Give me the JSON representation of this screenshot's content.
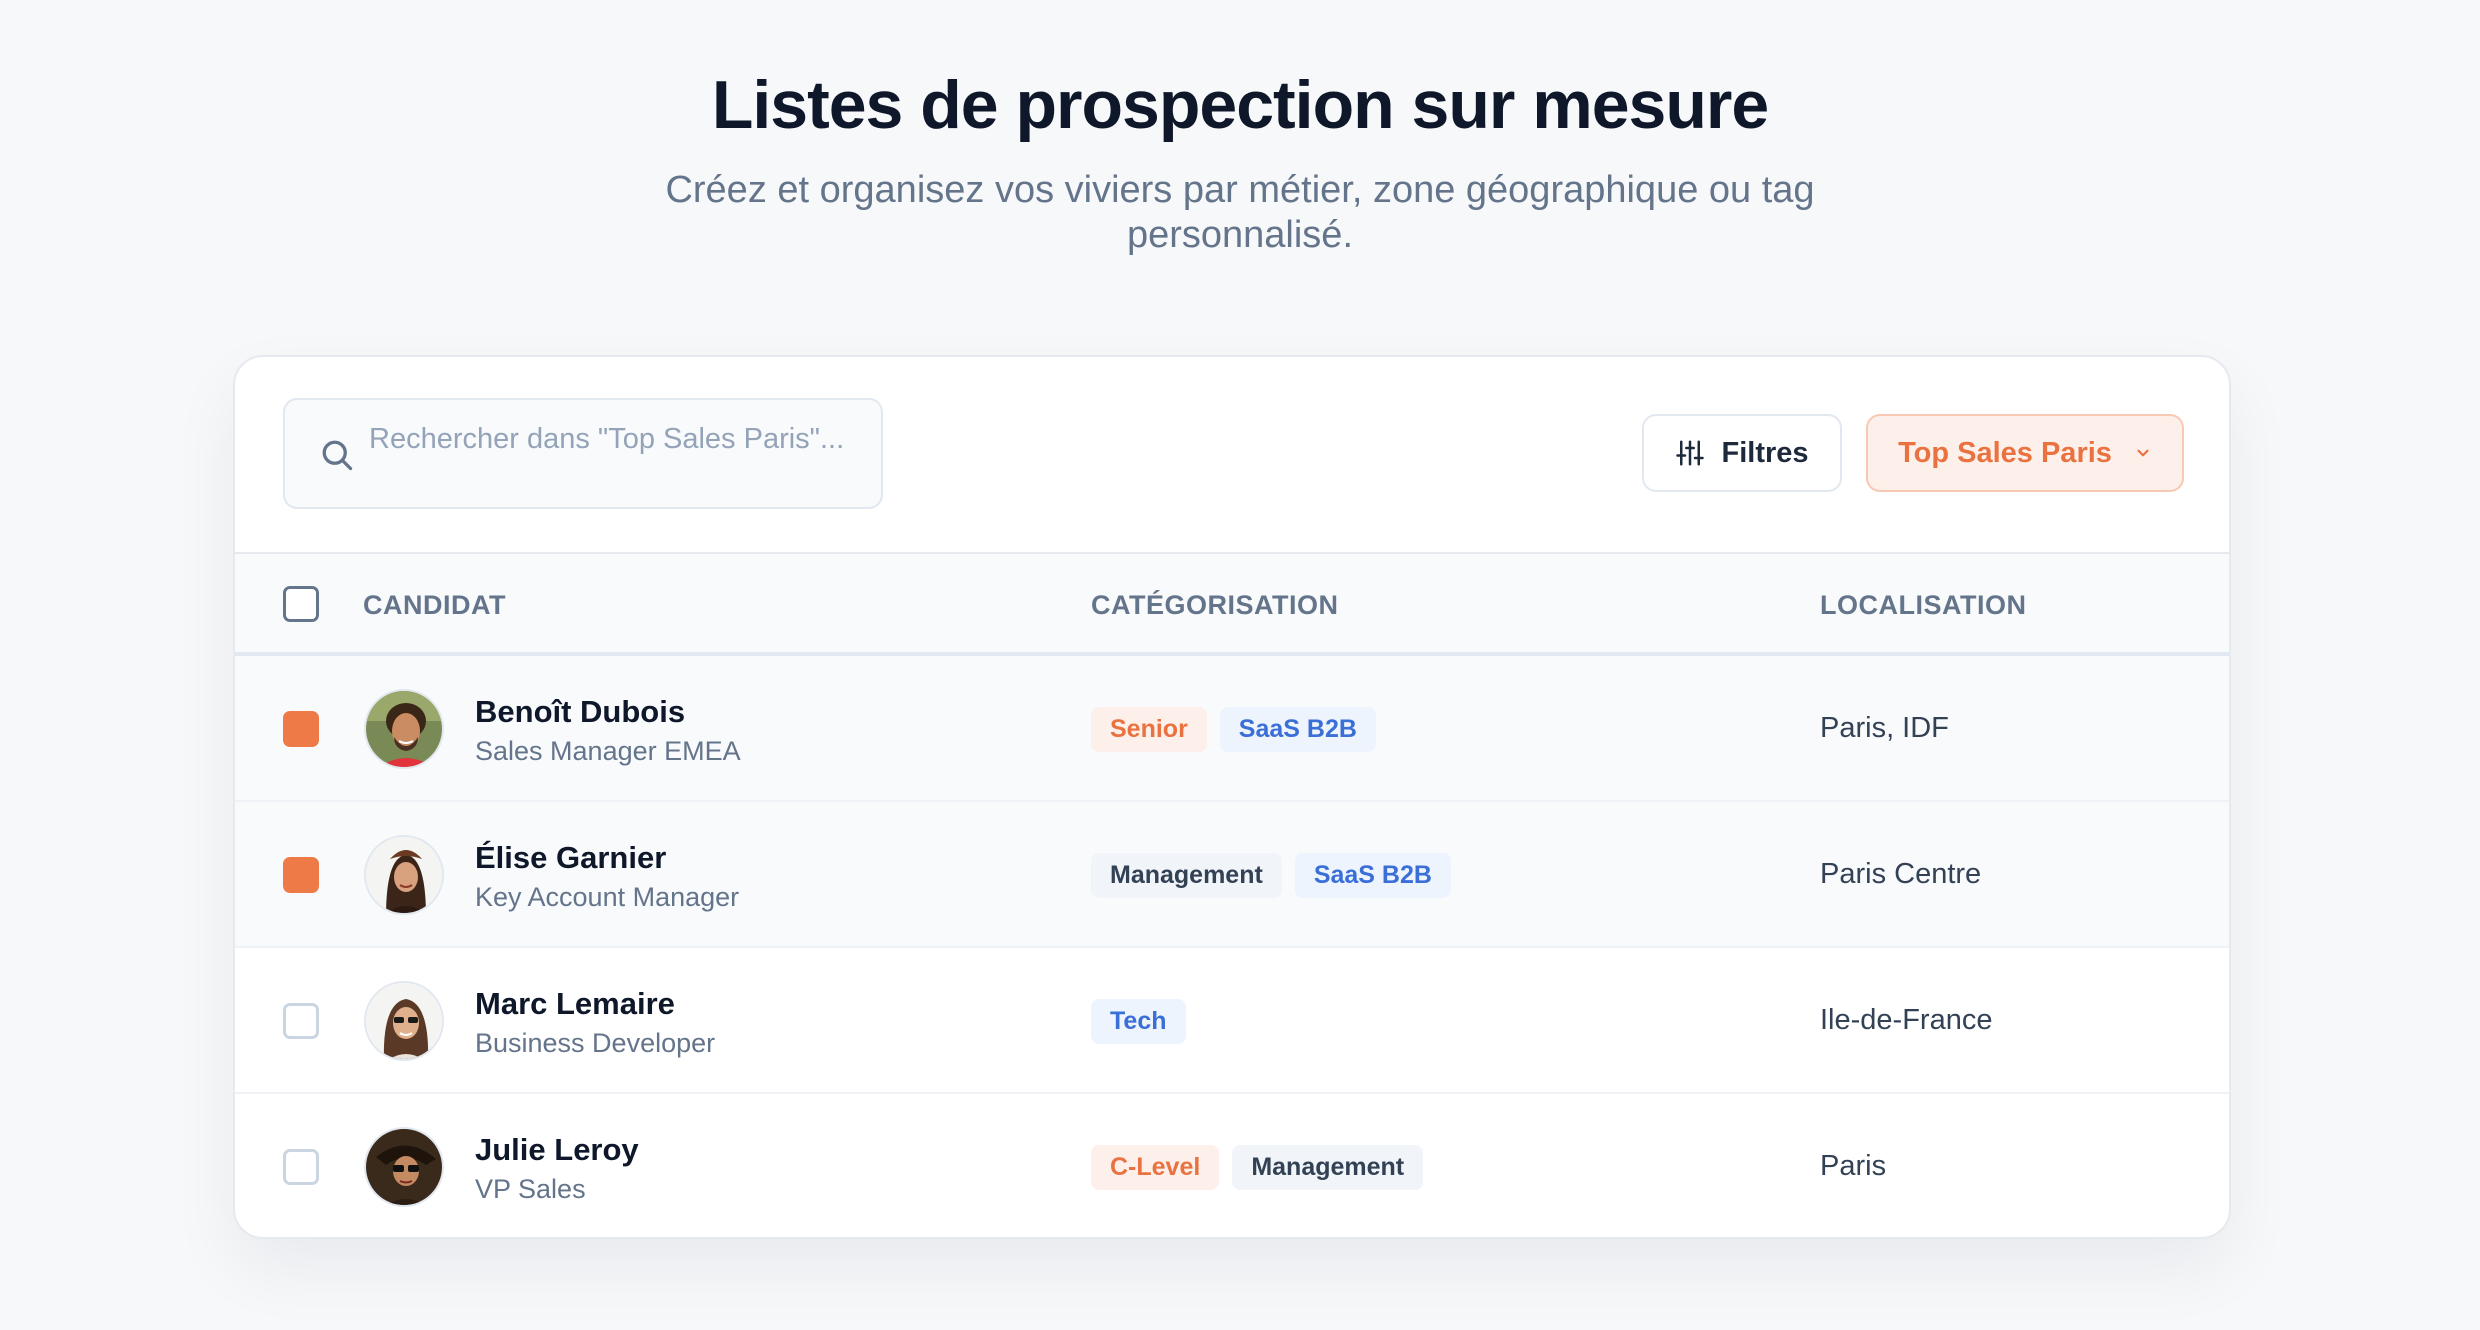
{
  "header": {
    "title": "Listes de prospection sur mesure",
    "subtitle": "Créez et organisez vos viviers par métier, zone géographique ou tag personnalisé."
  },
  "toolbar": {
    "search_placeholder": "Rechercher dans \"Top Sales Paris\"...",
    "filters_label": "Filtres",
    "list_selector_label": "Top Sales Paris"
  },
  "table": {
    "columns": [
      "CANDIDAT",
      "CATÉGORISATION",
      "LOCALISATION"
    ],
    "rows": [
      {
        "checked": true,
        "name": "Benoît Dubois",
        "role": "Sales Manager EMEA",
        "tags": [
          {
            "label": "Senior",
            "color": "orange"
          },
          {
            "label": "SaaS B2B",
            "color": "blue"
          }
        ],
        "location": "Paris, IDF"
      },
      {
        "checked": true,
        "name": "Élise Garnier",
        "role": "Key Account Manager",
        "tags": [
          {
            "label": "Management",
            "color": "gray"
          },
          {
            "label": "SaaS B2B",
            "color": "blue"
          }
        ],
        "location": "Paris Centre"
      },
      {
        "checked": false,
        "name": "Marc Lemaire",
        "role": "Business Developer",
        "tags": [
          {
            "label": "Tech",
            "color": "blue"
          }
        ],
        "location": "Ile-de-France"
      },
      {
        "checked": false,
        "name": "Julie Leroy",
        "role": "VP Sales",
        "tags": [
          {
            "label": "C-Level",
            "color": "orange"
          },
          {
            "label": "Management",
            "color": "gray"
          }
        ],
        "location": "Paris"
      }
    ]
  },
  "colors": {
    "accent": "#ee7a48",
    "tag_orange_bg": "#fdf0ea",
    "tag_blue_bg": "#eef4fd",
    "tag_gray_bg": "#f1f5f9"
  }
}
